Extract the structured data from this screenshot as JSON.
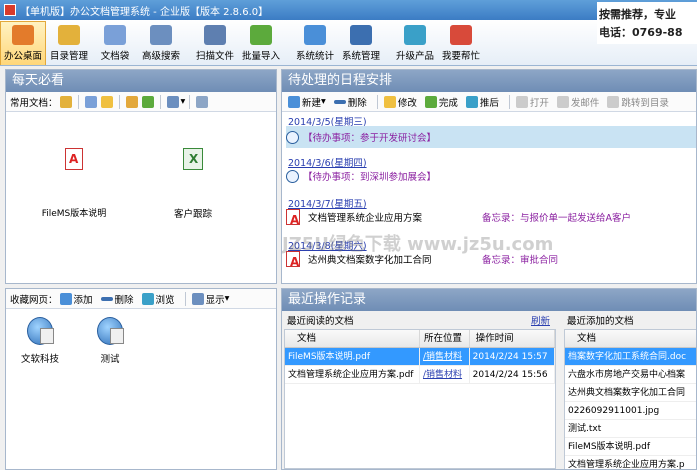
{
  "window": {
    "title": "【单机版】办公文档管理系统 - 企业版【版本 2.8.6.0】"
  },
  "toolbar": {
    "items": [
      {
        "label": "办公桌面",
        "icon": "home-icon",
        "color": "#e37b2b"
      },
      {
        "label": "目录管理",
        "icon": "folder-icon",
        "color": "#e3b13b"
      },
      {
        "label": "文档袋",
        "icon": "document-bag-icon",
        "color": "#7aa0d8"
      },
      {
        "label": "高级搜索",
        "icon": "search-icon",
        "color": "#6c8fbf"
      },
      {
        "label": "扫描文件",
        "icon": "scanner-icon",
        "color": "#5e7fb0"
      },
      {
        "label": "批量导入",
        "icon": "import-icon",
        "color": "#5caa3c"
      },
      {
        "label": "系统统计",
        "icon": "statistics-icon",
        "color": "#4a8fd8"
      },
      {
        "label": "系统管理",
        "icon": "users-icon",
        "color": "#3c6fb0"
      },
      {
        "label": "升级产品",
        "icon": "upgrade-icon",
        "color": "#3aa0c8"
      },
      {
        "label": "我要帮忙",
        "icon": "help-icon",
        "color": "#d84a3a"
      }
    ],
    "ad_line1": "按需推荐，专业",
    "ad_line2": "电话：0769-88"
  },
  "daily": {
    "title": "每天必看",
    "common_label": "常用文档：",
    "docs": [
      {
        "name": "FileMS版本说明",
        "icon": "pdf-icon"
      },
      {
        "name": "客户跟踪",
        "icon": "spreadsheet-icon"
      }
    ]
  },
  "favorites": {
    "label": "收藏网页：",
    "add": "添加",
    "delete": "删除",
    "browse": "浏览",
    "display": "显示",
    "items": [
      {
        "name": "文软科技"
      },
      {
        "name": "测试"
      }
    ]
  },
  "schedule": {
    "title": "待处理的日程安排",
    "toolbar": {
      "new": "新建",
      "delete": "删除",
      "edit": "修改",
      "complete": "完成",
      "postpone": "推后",
      "open": "打开",
      "send_mail": "发邮件",
      "jump": "跳转到目录"
    },
    "entries": [
      {
        "date": "2014/3/5(星期三)",
        "text": "【待办事项：参于开发研讨会】",
        "type": "todo",
        "memo": ""
      },
      {
        "date": "2014/3/6(星期四)",
        "text": "【待办事项：到深圳参加展会】",
        "type": "todo",
        "memo": ""
      },
      {
        "date": "2014/3/7(星期五)",
        "text": "文档管理系统企业应用方案",
        "type": "doc",
        "memo": "备忘录：与报价单一起发送给A客户"
      },
      {
        "date": "2014/3/8(星期六)",
        "text": "达州典文档案数字化加工合同",
        "type": "doc",
        "memo": "备忘录：审批合同"
      }
    ]
  },
  "recent": {
    "title": "最近操作记录",
    "read": {
      "title": "最近阅读的文档",
      "refresh": "刷新",
      "columns": [
        "文档",
        "所在位置",
        "操作时间"
      ],
      "rows": [
        {
          "doc": "FileMS版本说明.pdf",
          "location": "/销售材料",
          "time": "2014/2/24 15:57"
        },
        {
          "doc": "文档管理系统企业应用方案.pdf",
          "location": "/销售材料",
          "time": "2014/2/24 15:56"
        }
      ]
    },
    "added": {
      "title": "最近添加的文档",
      "columns": [
        "文档"
      ],
      "rows": [
        "档案数字化加工系统合同.doc",
        "六盘水市房地产交易中心档案",
        "达州典文档案数字化加工合同",
        "0226092911001.jpg",
        "测试.txt",
        "FileMS版本说明.pdf",
        "文档管理系统企业应用方案.p"
      ]
    }
  },
  "watermark": "JZ5U绿色下载 www.jz5u.com"
}
